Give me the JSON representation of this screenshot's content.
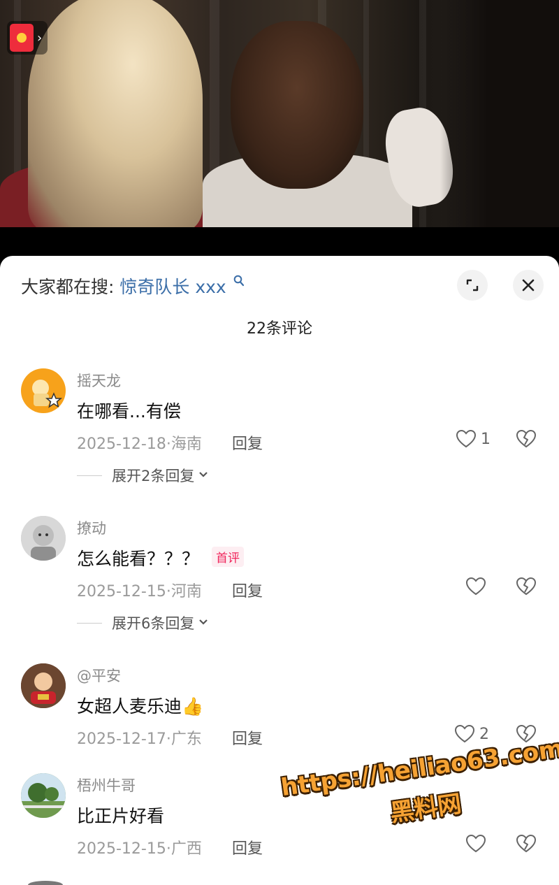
{
  "search": {
    "prefix": "大家都在搜:",
    "keyword": "惊奇队长 xxx"
  },
  "comment_count": "22条评论",
  "actions": {
    "expand_icon": "expand-icon",
    "close_icon": "close-icon"
  },
  "comments": [
    {
      "username": "摇天龙",
      "text": "在哪看...有偿",
      "date_location": "2025-12-18·海南",
      "reply_label": "回复",
      "likes": "1",
      "expand_replies": "展开2条回复"
    },
    {
      "username": "撩动",
      "text": "怎么能看？？？",
      "badge": "首评",
      "date_location": "2025-12-15·河南",
      "reply_label": "回复",
      "likes": "",
      "expand_replies": "展开6条回复"
    },
    {
      "username": "@平安",
      "text": "女超人麦乐迪",
      "emoji": "👍",
      "date_location": "2025-12-17·广东",
      "reply_label": "回复",
      "likes": "2"
    },
    {
      "username": "梧州牛哥",
      "text": "比正片好看",
      "date_location": "2025-12-15·广西",
      "reply_label": "回复",
      "likes": ""
    }
  ],
  "watermark": {
    "url": "https://heiliao63.com",
    "name": "黑料网"
  },
  "colors": {
    "keyword": "#3b6ea8",
    "badge": "#f0265c",
    "watermark": "#f6a233"
  }
}
